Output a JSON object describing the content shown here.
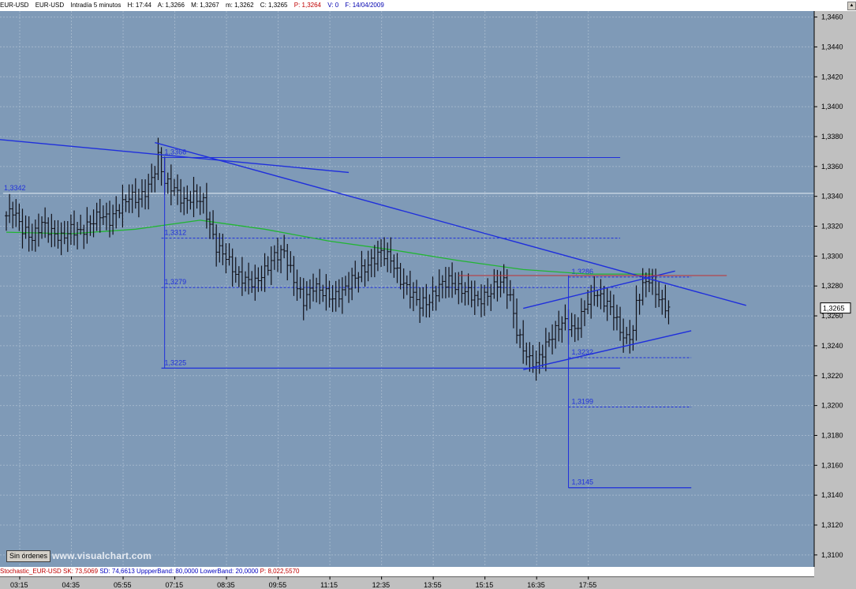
{
  "header": {
    "symbol": "EUR-USD",
    "name": "EUR-USD",
    "timeframe": "Intradía 5 minutos",
    "time_label": "H: 17:44",
    "fields": [
      "A: 1,3266",
      "M: 1,3267",
      "m: 1,3262",
      "C: 1,3265"
    ],
    "p_value": "P: 1,3264",
    "v_value": "V: 0",
    "date": "F: 14/04/2009"
  },
  "controls": {
    "orders_button": "Sin órdenes",
    "watermark": "www.visualchart.com"
  },
  "indicator_bar": {
    "name": "Stochastic_EUR-USD",
    "sk": "SK: 73,5069",
    "sd": "SD: 74,6613",
    "upper": "UppperBand: 80,0000",
    "lower": "LowerBand: 20,0000",
    "p": "P: 8,022,5570"
  },
  "colors": {
    "plot_bg": "#7f9ab7",
    "grid": "#a2b6cb",
    "bars": "#101018",
    "trend": "#1f2fdc",
    "ma": "#22b533",
    "resistance": "#c03030",
    "reference": "#e8eef5"
  },
  "chart_data": {
    "type": "ohlc_bars",
    "timeframe_minutes": 5,
    "x_tick_labels": [
      "03:15",
      "04:35",
      "05:55",
      "07:15",
      "08:35",
      "09:55",
      "11:15",
      "12:35",
      "13:55",
      "15:15",
      "16:35",
      "17:55"
    ],
    "y_tick_labels": [
      "1,3100",
      "1,3120",
      "1,3140",
      "1,3160",
      "1,3180",
      "1,3200",
      "1,3220",
      "1,3240",
      "1,3260",
      "1,3280",
      "1,3300",
      "1,3320",
      "1,3340",
      "1,3360",
      "1,3380",
      "1,3400",
      "1,3420",
      "1,3440",
      "1,3460"
    ],
    "ylim": [
      1.3092,
      1.3464
    ],
    "last_price_label": "1,3265",
    "last_price": 1.3265,
    "grid": true,
    "price_path": [
      [
        0,
        1.3327
      ],
      [
        2,
        1.3331
      ],
      [
        5,
        1.3318
      ],
      [
        8,
        1.3312
      ],
      [
        11,
        1.3322
      ],
      [
        14,
        1.3316
      ],
      [
        17,
        1.3312
      ],
      [
        20,
        1.3318
      ],
      [
        23,
        1.3316
      ],
      [
        26,
        1.3322
      ],
      [
        29,
        1.3328
      ],
      [
        32,
        1.3324
      ],
      [
        35,
        1.3332
      ],
      [
        38,
        1.334
      ],
      [
        41,
        1.3338
      ],
      [
        44,
        1.3346
      ],
      [
        46,
        1.3358
      ],
      [
        47,
        1.3366
      ],
      [
        49,
        1.335
      ],
      [
        52,
        1.3345
      ],
      [
        55,
        1.3336
      ],
      [
        58,
        1.334
      ],
      [
        61,
        1.3336
      ],
      [
        63,
        1.332
      ],
      [
        65,
        1.3306
      ],
      [
        68,
        1.33
      ],
      [
        71,
        1.3288
      ],
      [
        74,
        1.3284
      ],
      [
        77,
        1.3282
      ],
      [
        80,
        1.329
      ],
      [
        83,
        1.33
      ],
      [
        86,
        1.3303
      ],
      [
        89,
        1.3284
      ],
      [
        92,
        1.327
      ],
      [
        95,
        1.328
      ],
      [
        98,
        1.3276
      ],
      [
        101,
        1.3272
      ],
      [
        104,
        1.3276
      ],
      [
        107,
        1.3284
      ],
      [
        110,
        1.329
      ],
      [
        113,
        1.3296
      ],
      [
        116,
        1.3303
      ],
      [
        119,
        1.3298
      ],
      [
        122,
        1.3284
      ],
      [
        125,
        1.3276
      ],
      [
        128,
        1.3268
      ],
      [
        131,
        1.327
      ],
      [
        134,
        1.328
      ],
      [
        137,
        1.3284
      ],
      [
        140,
        1.3278
      ],
      [
        143,
        1.3276
      ],
      [
        146,
        1.327
      ],
      [
        149,
        1.3274
      ],
      [
        152,
        1.3282
      ],
      [
        154,
        1.3283
      ],
      [
        156,
        1.3272
      ],
      [
        158,
        1.325
      ],
      [
        160,
        1.3238
      ],
      [
        162,
        1.323
      ],
      [
        164,
        1.3228
      ],
      [
        166,
        1.3236
      ],
      [
        168,
        1.3244
      ],
      [
        170,
        1.325
      ],
      [
        172,
        1.3256
      ],
      [
        174,
        1.3254
      ],
      [
        176,
        1.325
      ],
      [
        178,
        1.326
      ],
      [
        180,
        1.327
      ],
      [
        182,
        1.3276
      ],
      [
        184,
        1.3272
      ],
      [
        186,
        1.3268
      ],
      [
        188,
        1.3262
      ],
      [
        190,
        1.325
      ],
      [
        192,
        1.3244
      ],
      [
        194,
        1.325
      ],
      [
        195,
        1.3268
      ],
      [
        197,
        1.328
      ],
      [
        199,
        1.3285
      ],
      [
        201,
        1.3276
      ],
      [
        203,
        1.3268
      ],
      [
        205,
        1.3265
      ]
    ],
    "moving_average": [
      [
        0,
        1.3316
      ],
      [
        20,
        1.3315
      ],
      [
        40,
        1.3318
      ],
      [
        60,
        1.3324
      ],
      [
        80,
        1.3318
      ],
      [
        100,
        1.331
      ],
      [
        120,
        1.3304
      ],
      [
        140,
        1.3297
      ],
      [
        160,
        1.3291
      ],
      [
        180,
        1.3288
      ],
      [
        200,
        1.3288
      ]
    ],
    "lines": [
      {
        "kind": "trend",
        "from": [
          -2,
          1.3378
        ],
        "to": [
          106,
          1.3356
        ]
      },
      {
        "kind": "trend",
        "from": [
          46,
          1.3376
        ],
        "to": [
          229,
          1.3267
        ]
      },
      {
        "kind": "trend",
        "from": [
          160,
          1.3224
        ],
        "to": [
          212,
          1.325
        ]
      },
      {
        "kind": "trend",
        "from": [
          160,
          1.3265
        ],
        "to": [
          207,
          1.329
        ]
      },
      {
        "kind": "horizontal",
        "from": [
          48,
          1.3366
        ],
        "to": [
          190,
          1.3366
        ]
      },
      {
        "kind": "horizontal",
        "from": [
          48,
          1.3225
        ],
        "to": [
          190,
          1.3225
        ]
      },
      {
        "kind": "horizontal",
        "from": [
          140,
          1.3287
        ],
        "to": [
          223,
          1.3287
        ],
        "color": "resistance"
      },
      {
        "kind": "horizontal",
        "from": [
          174,
          1.3145
        ],
        "to": [
          212,
          1.3145
        ]
      }
    ],
    "vertical_segments": [
      {
        "x": 49,
        "from": 1.3366,
        "to": 1.3225
      },
      {
        "x": 174,
        "from": 1.3287,
        "to": 1.3145
      }
    ],
    "reference_lines": [
      {
        "value": 1.3342,
        "label": "1,3342",
        "x_start": -1
      }
    ],
    "levels": [
      {
        "value": 1.3366,
        "label": "1,3366",
        "x_start": 48,
        "x_end": 190,
        "style": "solid"
      },
      {
        "value": 1.3312,
        "label": "1,3312",
        "x_start": 48,
        "x_end": 190,
        "style": "dashed"
      },
      {
        "value": 1.3279,
        "label": "1,3279",
        "x_start": 48,
        "x_end": 190,
        "style": "dashed"
      },
      {
        "value": 1.3225,
        "label": "1,3225",
        "x_start": 48,
        "x_end": 190,
        "style": "solid"
      },
      {
        "value": 1.3286,
        "label": "1,3286",
        "x_start": 174,
        "x_end": 212,
        "style": "dashed"
      },
      {
        "value": 1.3232,
        "label": "1,3232",
        "x_start": 174,
        "x_end": 212,
        "style": "dashed"
      },
      {
        "value": 1.3199,
        "label": "1,3199",
        "x_start": 174,
        "x_end": 212,
        "style": "dashed"
      },
      {
        "value": 1.3145,
        "label": "1,3145",
        "x_start": 174,
        "x_end": 212,
        "style": "solid"
      }
    ]
  }
}
